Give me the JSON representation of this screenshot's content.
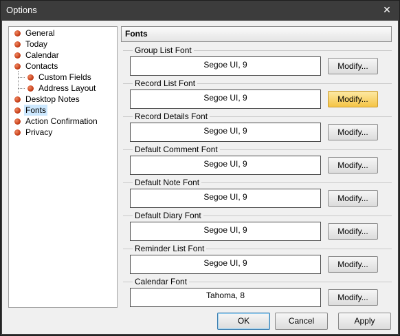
{
  "window": {
    "title": "Options",
    "close_glyph": "✕"
  },
  "tree": {
    "items": [
      {
        "label": "General"
      },
      {
        "label": "Today"
      },
      {
        "label": "Calendar"
      },
      {
        "label": "Contacts"
      },
      {
        "label": "Custom Fields"
      },
      {
        "label": "Address Layout"
      },
      {
        "label": "Desktop Notes"
      },
      {
        "label": "Fonts"
      },
      {
        "label": "Action Confirmation"
      },
      {
        "label": "Privacy"
      }
    ],
    "selected": "Fonts"
  },
  "panel": {
    "header": "Fonts",
    "modify_label": "Modify...",
    "groups": [
      {
        "label": "Group List Font",
        "value": "Segoe UI, 9"
      },
      {
        "label": "Record List Font",
        "value": "Segoe UI, 9"
      },
      {
        "label": "Record Details Font",
        "value": "Segoe UI, 9"
      },
      {
        "label": "Default Comment Font",
        "value": "Segoe UI, 9"
      },
      {
        "label": "Default Note Font",
        "value": "Segoe UI, 9"
      },
      {
        "label": "Default Diary Font",
        "value": "Segoe UI, 9"
      },
      {
        "label": "Reminder List Font",
        "value": "Segoe UI, 9"
      },
      {
        "label": "Calendar Font",
        "value": "Tahoma, 8"
      }
    ]
  },
  "buttons": {
    "ok": "OK",
    "cancel": "Cancel",
    "apply": "Apply"
  },
  "colors": {
    "accent_hover": "#f5c445",
    "selection": "#cce8ff",
    "bullet": "#c8401a"
  }
}
